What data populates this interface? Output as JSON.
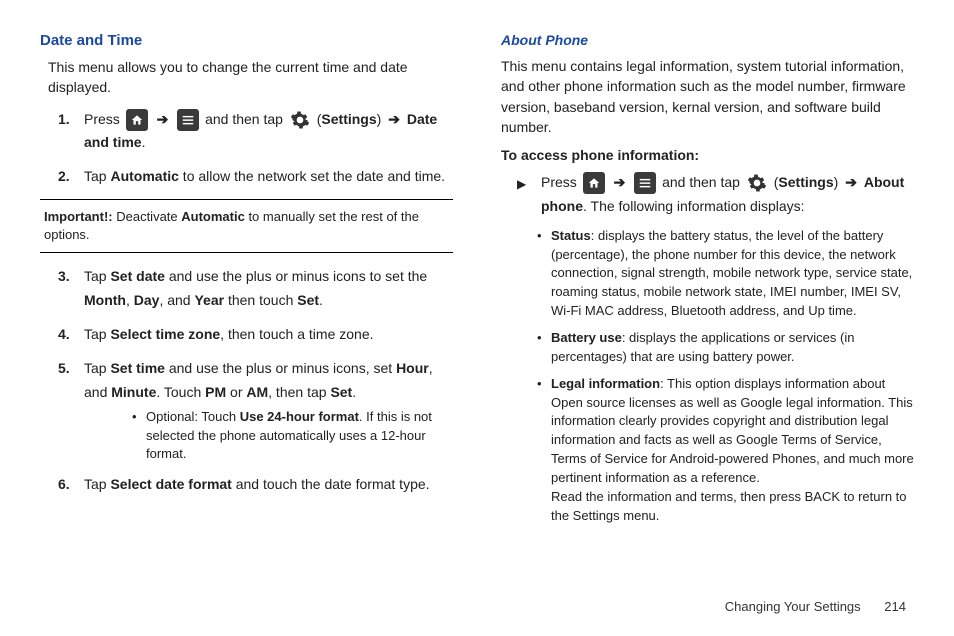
{
  "left": {
    "heading": "Date and Time",
    "intro": "This menu allows you to change the current time and date displayed.",
    "step1_a": "Press ",
    "step1_b": " and then tap ",
    "step1_c": " (",
    "step1_settings": "Settings",
    "step1_d": ") ",
    "step1_e": "Date and time",
    "step1_f": ".",
    "step2_a": "Tap ",
    "step2_b": "Automatic",
    "step2_c": " to allow the network set the date and time.",
    "important_label": "Important!:",
    "important_a": " Deactivate ",
    "important_b": "Automatic",
    "important_c": " to manually set the rest of the options.",
    "step3_a": "Tap ",
    "step3_b": "Set date",
    "step3_c": " and use the plus or minus icons to set the ",
    "step3_d": "Month",
    "step3_e": ", ",
    "step3_f": "Day",
    "step3_g": ", and ",
    "step3_h": "Year",
    "step3_i": " then touch ",
    "step3_j": "Set",
    "step3_k": ".",
    "step4_a": "Tap ",
    "step4_b": "Select time zone",
    "step4_c": ", then touch a time zone.",
    "step5_a": "Tap ",
    "step5_b": "Set time",
    "step5_c": " and use the plus or minus icons, set ",
    "step5_d": "Hour",
    "step5_e": ", and ",
    "step5_f": "Minute",
    "step5_g": ". Touch ",
    "step5_h": "PM",
    "step5_i": " or ",
    "step5_j": "AM",
    "step5_k": ", then tap ",
    "step5_l": "Set",
    "step5_m": ".",
    "step5_sub_a": "Optional: Touch ",
    "step5_sub_b": "Use 24-hour format",
    "step5_sub_c": ". If this is not selected the phone automatically uses a 12-hour format.",
    "step6_a": "Tap ",
    "step6_b": "Select date format",
    "step6_c": " and touch the date format type."
  },
  "right": {
    "heading": "About Phone",
    "intro": "This menu contains legal information, system tutorial information, and other phone information such as the model number, firmware version, baseband version, kernal version, and software build number.",
    "access_h": "To access phone information:",
    "press_a": "Press ",
    "press_b": " and then tap ",
    "press_c": " (",
    "press_settings": "Settings",
    "press_d": ") ",
    "press_e": "About phone",
    "press_f": ". The following information displays:",
    "b1_h": "Status",
    "b1_t": ": displays the battery status, the level of the battery (percentage), the phone number for this device, the network connection, signal strength, mobile network type, service state, roaming status, mobile network state, IMEI number, IMEI SV, Wi-Fi MAC address, Bluetooth address, and Up time.",
    "b2_h": "Battery use",
    "b2_t": ": displays the applications or services (in percentages) that are using battery power.",
    "b3_h": "Legal information",
    "b3_t": ": This option displays information about Open source licenses as well as Google legal information. This information clearly provides copyright and distribution legal information and facts as well as Google Terms of Service, Terms of Service for Android-powered Phones, and much more pertinent information as a reference.",
    "b3_t2": "Read the information and terms, then press BACK to return to the Settings menu."
  },
  "footer": {
    "section": "Changing Your Settings",
    "page": "214"
  },
  "nums": {
    "n1": "1.",
    "n2": "2.",
    "n3": "3.",
    "n4": "4.",
    "n5": "5.",
    "n6": "6."
  },
  "glyphs": {
    "arrow": "➔",
    "bullet": "•",
    "tri": "▶"
  }
}
